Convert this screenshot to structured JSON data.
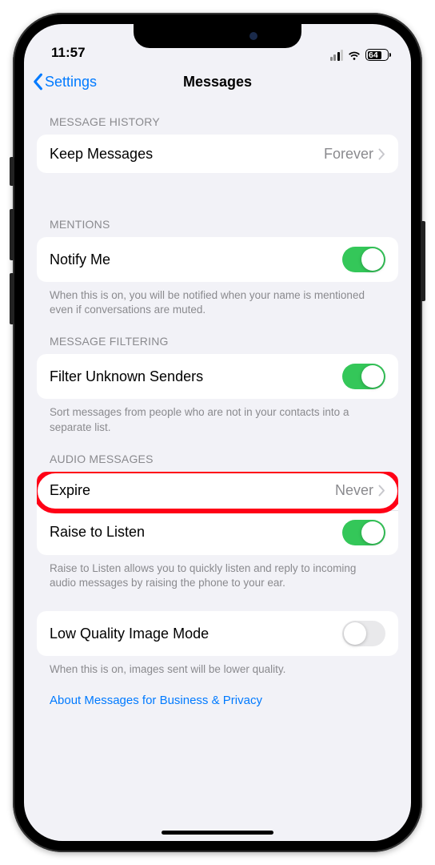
{
  "status": {
    "time": "11:57",
    "battery": "64"
  },
  "nav": {
    "back": "Settings",
    "title": "Messages"
  },
  "sections": {
    "message_history": {
      "header": "MESSAGE HISTORY",
      "keep_messages": {
        "label": "Keep Messages",
        "value": "Forever"
      }
    },
    "mentions": {
      "header": "MENTIONS",
      "notify_me": {
        "label": "Notify Me"
      },
      "footer": "When this is on, you will be notified when your name is mentioned even if conversations are muted."
    },
    "message_filtering": {
      "header": "MESSAGE FILTERING",
      "filter_unknown": {
        "label": "Filter Unknown Senders"
      },
      "footer": "Sort messages from people who are not in your contacts into a separate list."
    },
    "audio_messages": {
      "header": "AUDIO MESSAGES",
      "expire": {
        "label": "Expire",
        "value": "Never"
      },
      "raise_to_listen": {
        "label": "Raise to Listen"
      },
      "footer": "Raise to Listen allows you to quickly listen and reply to incoming audio messages by raising the phone to your ear."
    },
    "image_mode": {
      "low_quality": {
        "label": "Low Quality Image Mode"
      },
      "footer": "When this is on, images sent will be lower quality."
    }
  },
  "link": "About Messages for Business & Privacy"
}
